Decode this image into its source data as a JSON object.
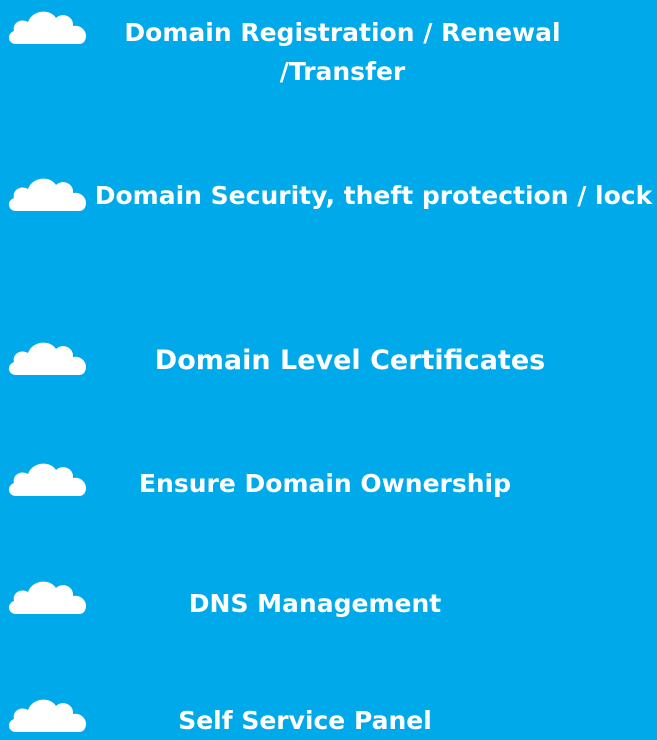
{
  "background_color": "#00a9ea",
  "text_color": "#ffffff",
  "icon": "cloud-icon",
  "features": [
    {
      "label": "Domain Registration / Renewal /Transfer"
    },
    {
      "label": "Domain Security, theft protection / lock"
    },
    {
      "label": "Domain Level Certificates"
    },
    {
      "label": "Ensure Domain Ownership"
    },
    {
      "label": "DNS Management"
    },
    {
      "label": "Self Service Panel"
    }
  ]
}
